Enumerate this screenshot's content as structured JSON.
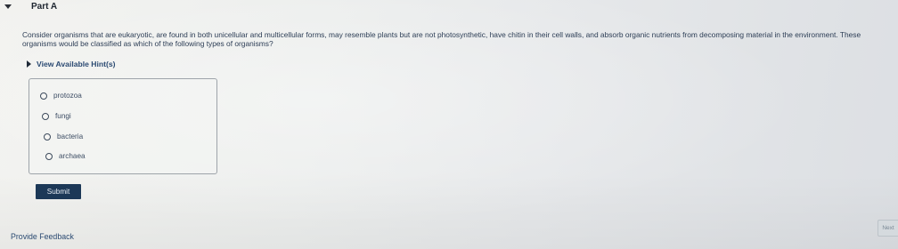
{
  "part": {
    "title": "Part A"
  },
  "question": {
    "text": "Consider organisms that are eukaryotic, are found in both unicellular and multicellular forms, may resemble plants but are not photosynthetic, have chitin in their cell walls, and absorb organic nutrients from decomposing material in the environment. These organisms would be classified as which of the following types of organisms?"
  },
  "hints": {
    "label": "View Available Hint(s)"
  },
  "choices": [
    {
      "label": "protozoa"
    },
    {
      "label": "fungi"
    },
    {
      "label": "bacteria"
    },
    {
      "label": "archaea"
    }
  ],
  "buttons": {
    "submit": "Submit",
    "next": "Next"
  },
  "footer": {
    "feedback": "Provide Feedback"
  },
  "colors": {
    "submit_bg": "#1c3857",
    "link": "#2b4a72"
  },
  "icons": {
    "part_toggle": "caret-down-icon",
    "hints_toggle": "caret-right-icon",
    "choice_radio": "radio-unchecked-icon"
  }
}
